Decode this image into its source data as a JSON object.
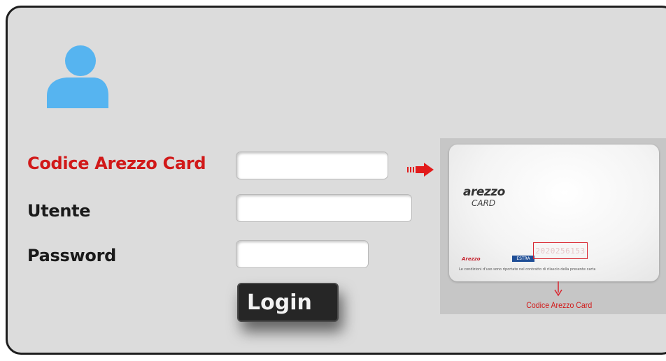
{
  "icons": {
    "user": "user-icon",
    "arrow": "arrow-right-icon",
    "arrow_down": "arrow-down-icon"
  },
  "colors": {
    "panel_bg": "#dcdcdc",
    "panel_border": "#1e1e1e",
    "accent_red": "#d11919",
    "user_icon": "#56b4f0",
    "button_bg": "#262626"
  },
  "form": {
    "card_code_label": "Codice Arezzo Card",
    "card_code_value": "",
    "username_label": "Utente",
    "username_value": "",
    "password_label": "Password",
    "password_value": "",
    "login_label": "Login"
  },
  "card_preview": {
    "logo_main": "arezzo",
    "logo_sub": "CARD",
    "brand_red": "Arezzo",
    "brand_blue": "ESTRA",
    "card_number": "2020256153",
    "fine_print": "Le condizioni d'uso sono riportate nel contratto di rilascio della presente carta",
    "caption": "Codice Arezzo Card"
  }
}
